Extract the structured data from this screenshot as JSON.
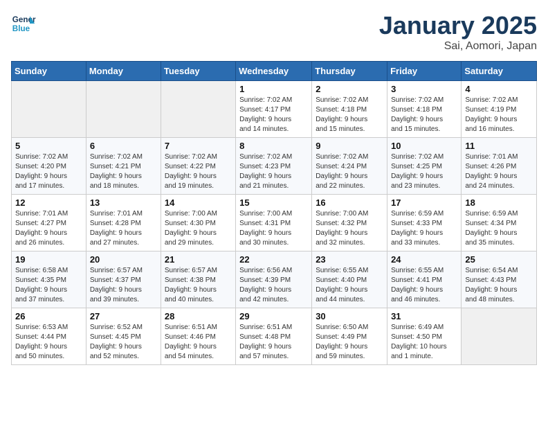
{
  "header": {
    "logo_line1": "General",
    "logo_line2": "Blue",
    "title": "January 2025",
    "subtitle": "Sai, Aomori, Japan"
  },
  "days_of_week": [
    "Sunday",
    "Monday",
    "Tuesday",
    "Wednesday",
    "Thursday",
    "Friday",
    "Saturday"
  ],
  "weeks": [
    [
      {
        "day": "",
        "info": ""
      },
      {
        "day": "",
        "info": ""
      },
      {
        "day": "",
        "info": ""
      },
      {
        "day": "1",
        "info": "Sunrise: 7:02 AM\nSunset: 4:17 PM\nDaylight: 9 hours\nand 14 minutes."
      },
      {
        "day": "2",
        "info": "Sunrise: 7:02 AM\nSunset: 4:18 PM\nDaylight: 9 hours\nand 15 minutes."
      },
      {
        "day": "3",
        "info": "Sunrise: 7:02 AM\nSunset: 4:18 PM\nDaylight: 9 hours\nand 15 minutes."
      },
      {
        "day": "4",
        "info": "Sunrise: 7:02 AM\nSunset: 4:19 PM\nDaylight: 9 hours\nand 16 minutes."
      }
    ],
    [
      {
        "day": "5",
        "info": "Sunrise: 7:02 AM\nSunset: 4:20 PM\nDaylight: 9 hours\nand 17 minutes."
      },
      {
        "day": "6",
        "info": "Sunrise: 7:02 AM\nSunset: 4:21 PM\nDaylight: 9 hours\nand 18 minutes."
      },
      {
        "day": "7",
        "info": "Sunrise: 7:02 AM\nSunset: 4:22 PM\nDaylight: 9 hours\nand 19 minutes."
      },
      {
        "day": "8",
        "info": "Sunrise: 7:02 AM\nSunset: 4:23 PM\nDaylight: 9 hours\nand 21 minutes."
      },
      {
        "day": "9",
        "info": "Sunrise: 7:02 AM\nSunset: 4:24 PM\nDaylight: 9 hours\nand 22 minutes."
      },
      {
        "day": "10",
        "info": "Sunrise: 7:02 AM\nSunset: 4:25 PM\nDaylight: 9 hours\nand 23 minutes."
      },
      {
        "day": "11",
        "info": "Sunrise: 7:01 AM\nSunset: 4:26 PM\nDaylight: 9 hours\nand 24 minutes."
      }
    ],
    [
      {
        "day": "12",
        "info": "Sunrise: 7:01 AM\nSunset: 4:27 PM\nDaylight: 9 hours\nand 26 minutes."
      },
      {
        "day": "13",
        "info": "Sunrise: 7:01 AM\nSunset: 4:28 PM\nDaylight: 9 hours\nand 27 minutes."
      },
      {
        "day": "14",
        "info": "Sunrise: 7:00 AM\nSunset: 4:30 PM\nDaylight: 9 hours\nand 29 minutes."
      },
      {
        "day": "15",
        "info": "Sunrise: 7:00 AM\nSunset: 4:31 PM\nDaylight: 9 hours\nand 30 minutes."
      },
      {
        "day": "16",
        "info": "Sunrise: 7:00 AM\nSunset: 4:32 PM\nDaylight: 9 hours\nand 32 minutes."
      },
      {
        "day": "17",
        "info": "Sunrise: 6:59 AM\nSunset: 4:33 PM\nDaylight: 9 hours\nand 33 minutes."
      },
      {
        "day": "18",
        "info": "Sunrise: 6:59 AM\nSunset: 4:34 PM\nDaylight: 9 hours\nand 35 minutes."
      }
    ],
    [
      {
        "day": "19",
        "info": "Sunrise: 6:58 AM\nSunset: 4:35 PM\nDaylight: 9 hours\nand 37 minutes."
      },
      {
        "day": "20",
        "info": "Sunrise: 6:57 AM\nSunset: 4:37 PM\nDaylight: 9 hours\nand 39 minutes."
      },
      {
        "day": "21",
        "info": "Sunrise: 6:57 AM\nSunset: 4:38 PM\nDaylight: 9 hours\nand 40 minutes."
      },
      {
        "day": "22",
        "info": "Sunrise: 6:56 AM\nSunset: 4:39 PM\nDaylight: 9 hours\nand 42 minutes."
      },
      {
        "day": "23",
        "info": "Sunrise: 6:55 AM\nSunset: 4:40 PM\nDaylight: 9 hours\nand 44 minutes."
      },
      {
        "day": "24",
        "info": "Sunrise: 6:55 AM\nSunset: 4:41 PM\nDaylight: 9 hours\nand 46 minutes."
      },
      {
        "day": "25",
        "info": "Sunrise: 6:54 AM\nSunset: 4:43 PM\nDaylight: 9 hours\nand 48 minutes."
      }
    ],
    [
      {
        "day": "26",
        "info": "Sunrise: 6:53 AM\nSunset: 4:44 PM\nDaylight: 9 hours\nand 50 minutes."
      },
      {
        "day": "27",
        "info": "Sunrise: 6:52 AM\nSunset: 4:45 PM\nDaylight: 9 hours\nand 52 minutes."
      },
      {
        "day": "28",
        "info": "Sunrise: 6:51 AM\nSunset: 4:46 PM\nDaylight: 9 hours\nand 54 minutes."
      },
      {
        "day": "29",
        "info": "Sunrise: 6:51 AM\nSunset: 4:48 PM\nDaylight: 9 hours\nand 57 minutes."
      },
      {
        "day": "30",
        "info": "Sunrise: 6:50 AM\nSunset: 4:49 PM\nDaylight: 9 hours\nand 59 minutes."
      },
      {
        "day": "31",
        "info": "Sunrise: 6:49 AM\nSunset: 4:50 PM\nDaylight: 10 hours\nand 1 minute."
      },
      {
        "day": "",
        "info": ""
      }
    ]
  ]
}
